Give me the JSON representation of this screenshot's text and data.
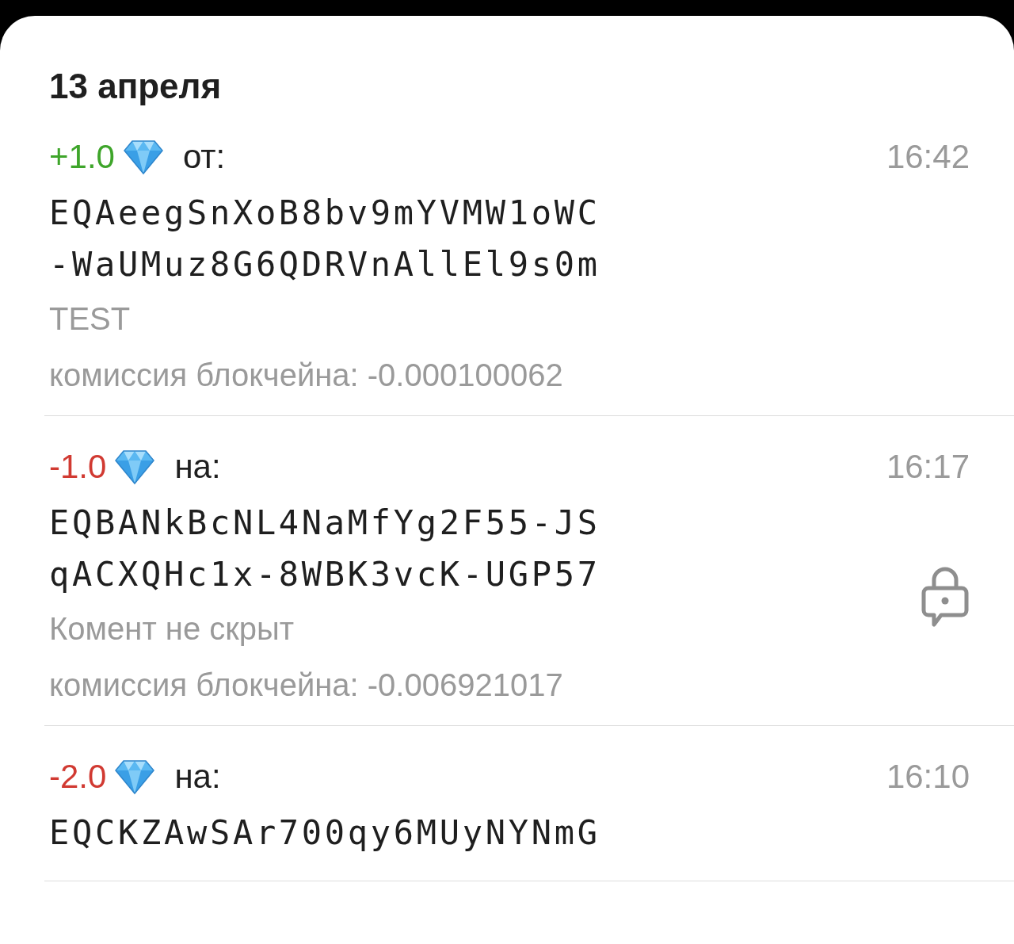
{
  "date_header": "13 апреля",
  "transactions": [
    {
      "kind": "incoming",
      "amount": "+1.0",
      "direction_label": "от:",
      "time": "16:42",
      "address_lines": [
        "EQAeegSnXoB8bv9mYVMW1oWC",
        "-WaUMuz8G6QDRVnAllEl9s0m"
      ],
      "comment": "TEST",
      "fee": "комиссия блокчейна: -0.000100062",
      "lock": false
    },
    {
      "kind": "outgoing",
      "amount": "-1.0",
      "direction_label": "на:",
      "time": "16:17",
      "address_lines": [
        "EQBANkBcNL4NaMfYg2F55-JS",
        "qACXQHc1x-8WBK3vcK-UGP57"
      ],
      "comment": "Комент не скрыт",
      "fee": "комиссия блокчейна: -0.006921017",
      "lock": true
    },
    {
      "kind": "outgoing",
      "amount": "-2.0",
      "direction_label": "на:",
      "time": "16:10",
      "address_lines": [
        "EQCKZAwSAr700qy6MUyNYNmG"
      ],
      "lock": false
    }
  ]
}
